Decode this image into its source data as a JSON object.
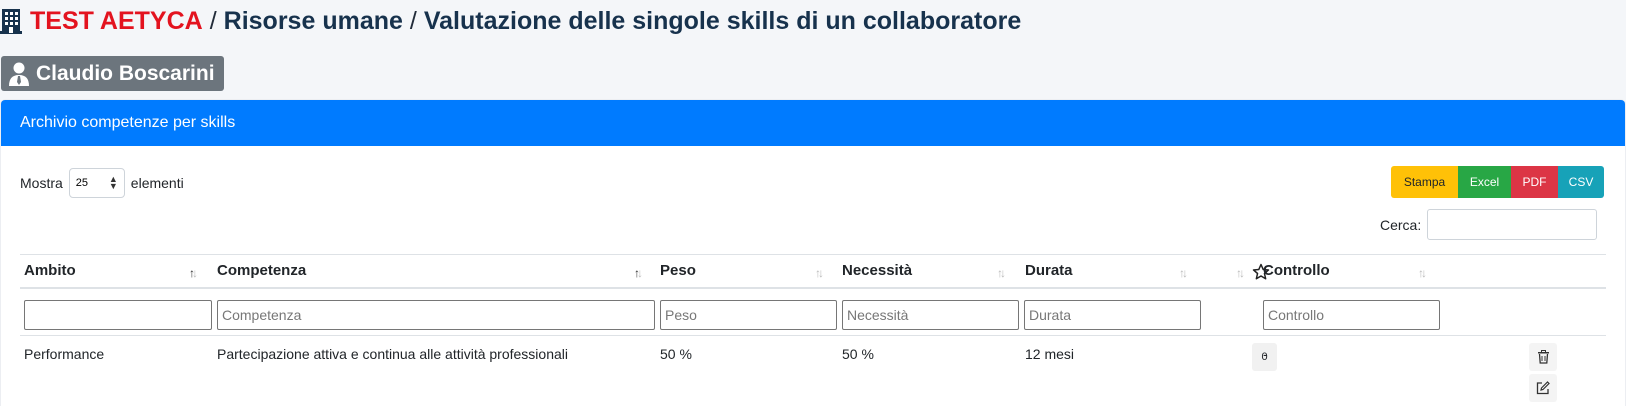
{
  "header": {
    "company": "TEST AETYCA",
    "separator": "/",
    "section": "Risorse umane",
    "page_title": "Valutazione delle singole skills di un collaboratore"
  },
  "user": {
    "name": "Claudio Boscarini"
  },
  "card": {
    "title": "Archivio competenze per skills"
  },
  "length_menu": {
    "prefix": "Mostra",
    "selected": "25",
    "suffix": "elementi"
  },
  "export_buttons": {
    "print": "Stampa",
    "excel": "Excel",
    "pdf": "PDF",
    "csv": "CSV"
  },
  "search": {
    "label": "Cerca:",
    "value": ""
  },
  "table": {
    "columns": [
      "Ambito",
      "Competenza",
      "Peso",
      "Necessità",
      "Durata",
      "Controllo"
    ],
    "filters": {
      "ambito": {
        "value": "",
        "placeholder": ""
      },
      "competenza": {
        "placeholder": "Competenza"
      },
      "peso": {
        "placeholder": "Peso"
      },
      "necessita": {
        "placeholder": "Necessità"
      },
      "durata": {
        "placeholder": "Durata"
      },
      "controllo": {
        "placeholder": "Controllo"
      }
    },
    "rows": [
      {
        "ambito": "Performance",
        "competenza": "Partecipazione attiva e continua alle attività professionali",
        "peso": "50 %",
        "necessita": "50 %",
        "durata": "12 mesi",
        "count": "0",
        "controllo": "-"
      }
    ]
  },
  "colors": {
    "company": "#e3131f",
    "card_header": "#007bff",
    "badge": "#6c757d",
    "print": "#ffc107",
    "excel": "#28a745",
    "pdf": "#dc3545",
    "csv": "#17a2b8"
  },
  "icons": {
    "building": "building-icon",
    "user": "user-tie-icon",
    "star": "star-icon",
    "delete": "trash-icon",
    "edit": "edit-icon"
  }
}
